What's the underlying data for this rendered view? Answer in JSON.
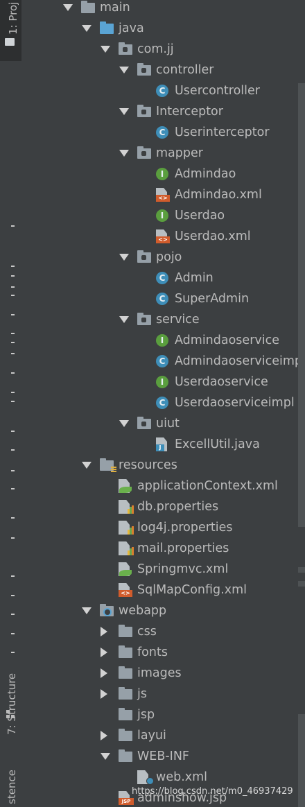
{
  "sidebar": {
    "tabs": [
      {
        "label": "1: Proj",
        "icon": "folder-icon"
      },
      {
        "label": "7: Structure",
        "icon": "structure-icon"
      },
      {
        "label": "stence"
      }
    ]
  },
  "tree": [
    {
      "label": "main",
      "icon": "folder-icon",
      "expanded": true
    },
    {
      "label": "java",
      "icon": "source-folder-icon",
      "expanded": true
    },
    {
      "label": "com.jj",
      "icon": "package-icon",
      "expanded": true
    },
    {
      "label": "controller",
      "icon": "package-icon",
      "expanded": true
    },
    {
      "label": "Usercontroller",
      "icon": "class-icon"
    },
    {
      "label": "Interceptor",
      "icon": "package-icon",
      "expanded": true
    },
    {
      "label": "Userinterceptor",
      "icon": "class-icon"
    },
    {
      "label": "mapper",
      "icon": "package-icon",
      "expanded": true
    },
    {
      "label": "Admindao",
      "icon": "interface-icon"
    },
    {
      "label": "Admindao.xml",
      "icon": "xml-file-icon"
    },
    {
      "label": "Userdao",
      "icon": "interface-icon"
    },
    {
      "label": "Userdao.xml",
      "icon": "xml-file-icon"
    },
    {
      "label": "pojo",
      "icon": "package-icon",
      "expanded": true
    },
    {
      "label": "Admin",
      "icon": "class-icon"
    },
    {
      "label": "SuperAdmin",
      "icon": "class-icon"
    },
    {
      "label": "service",
      "icon": "package-icon",
      "expanded": true
    },
    {
      "label": "Admindaoservice",
      "icon": "interface-icon"
    },
    {
      "label": "Admindaoserviceimpl",
      "icon": "class-icon"
    },
    {
      "label": "Userdaoservice",
      "icon": "interface-icon"
    },
    {
      "label": "Userdaoserviceimpl",
      "icon": "class-icon"
    },
    {
      "label": "uiut",
      "icon": "package-icon",
      "expanded": true
    },
    {
      "label": "ExcellUtil.java",
      "icon": "java-file-icon"
    },
    {
      "label": "resources",
      "icon": "resources-folder-icon",
      "expanded": true
    },
    {
      "label": "applicationContext.xml",
      "icon": "spring-xml-icon"
    },
    {
      "label": "db.properties",
      "icon": "properties-file-icon"
    },
    {
      "label": "log4j.properties",
      "icon": "properties-file-icon"
    },
    {
      "label": "mail.properties",
      "icon": "properties-file-icon"
    },
    {
      "label": "Springmvc.xml",
      "icon": "spring-xml-icon"
    },
    {
      "label": "SqlMapConfig.xml",
      "icon": "xml-file-icon"
    },
    {
      "label": "webapp",
      "icon": "web-folder-icon",
      "expanded": true
    },
    {
      "label": "css",
      "icon": "folder-icon",
      "expanded": false
    },
    {
      "label": "fonts",
      "icon": "folder-icon",
      "expanded": false
    },
    {
      "label": "images",
      "icon": "folder-icon",
      "expanded": false
    },
    {
      "label": "js",
      "icon": "folder-icon",
      "expanded": false
    },
    {
      "label": "jsp",
      "icon": "folder-icon"
    },
    {
      "label": "layui",
      "icon": "folder-icon",
      "expanded": false
    },
    {
      "label": "WEB-INF",
      "icon": "folder-icon",
      "expanded": true
    },
    {
      "label": "web.xml",
      "icon": "web-xml-icon"
    },
    {
      "label": "adminshow.jsp",
      "icon": "jsp-file-icon"
    }
  ],
  "watermark": "https://blog.csdn.net/m0_46937429",
  "colors": {
    "background": "#3c3f41",
    "text": "#bbbbbb",
    "class_icon": "#3e8eb8",
    "interface_icon": "#5a9e3e",
    "xml_badge": "#d15c2c",
    "source_folder": "#5aa4d4"
  }
}
